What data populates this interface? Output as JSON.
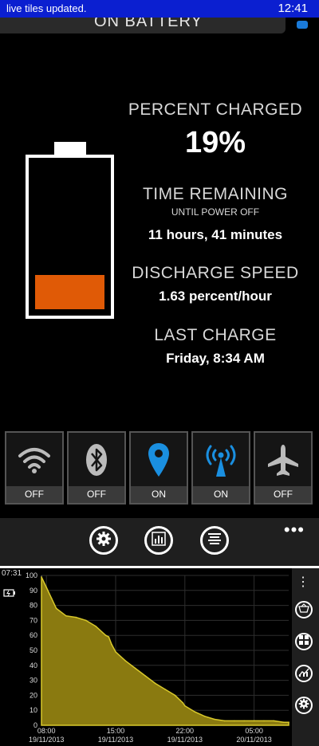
{
  "status_bar": {
    "notification": "live tiles updated.",
    "time": "12:41"
  },
  "header": {
    "title": "ON BATTERY"
  },
  "stats": {
    "percent_label": "PERCENT CHARGED",
    "percent_value": "19%",
    "time_label": "TIME REMAINING",
    "time_sub": "UNTIL POWER OFF",
    "time_value": "11 hours, 41 minutes",
    "discharge_label": "DISCHARGE SPEED",
    "discharge_value": "1.63 percent/hour",
    "last_charge_label": "LAST CHARGE",
    "last_charge_value": "Friday, 8:34 AM"
  },
  "battery_level": 0.19,
  "toggles": [
    {
      "name": "wifi",
      "icon": "wifi-icon",
      "state": "OFF"
    },
    {
      "name": "bluetooth",
      "icon": "bluetooth-icon",
      "state": "OFF"
    },
    {
      "name": "location",
      "icon": "location-pin-icon",
      "state": "ON"
    },
    {
      "name": "cellular",
      "icon": "cellular-antenna-icon",
      "state": "ON"
    },
    {
      "name": "airplane",
      "icon": "airplane-icon",
      "state": "OFF"
    }
  ],
  "app_bar": {
    "buttons": [
      "settings-icon",
      "bar-chart-icon",
      "list-icon"
    ],
    "more": "•••"
  },
  "colors": {
    "accent": "#1a8fe0",
    "battery_fill": "#e05a06",
    "status_bar": "#0b1fd0",
    "chart_fill": "#8a7a10"
  },
  "chart_panel": {
    "time": "07:31",
    "side_more": "⋮",
    "side_buttons": [
      "basket-icon",
      "tiles-icon",
      "trend-chart-icon",
      "settings-icon"
    ]
  },
  "chart_data": {
    "type": "area",
    "title": "",
    "xlabel": "",
    "ylabel": "",
    "ylim": [
      0,
      100
    ],
    "yticks": [
      0,
      10,
      20,
      30,
      40,
      50,
      60,
      70,
      80,
      90,
      100
    ],
    "xlim": [
      7.5,
      32.5
    ],
    "xticks": [
      {
        "at": 8,
        "time": "08:00",
        "date": "19/11/2013"
      },
      {
        "at": 15,
        "time": "15:00",
        "date": "19/11/2013"
      },
      {
        "at": 22,
        "time": "22:00",
        "date": "19/11/2013"
      },
      {
        "at": 29,
        "time": "05:00",
        "date": "20/11/2013"
      }
    ],
    "x": [
      7.5,
      8,
      8.5,
      9,
      10,
      11,
      12,
      13,
      14,
      14.3,
      14.6,
      15,
      16,
      17,
      18,
      19,
      20,
      21,
      21.8,
      22,
      23,
      24,
      25,
      26,
      27,
      28,
      29,
      30,
      31,
      32,
      32.5
    ],
    "values": [
      99,
      92,
      85,
      78,
      73,
      72,
      70,
      66,
      60,
      59,
      54,
      49,
      43,
      38,
      33,
      28,
      24,
      20,
      15,
      13,
      9,
      6,
      4,
      3,
      3,
      3,
      3,
      3,
      3,
      2,
      2
    ]
  }
}
